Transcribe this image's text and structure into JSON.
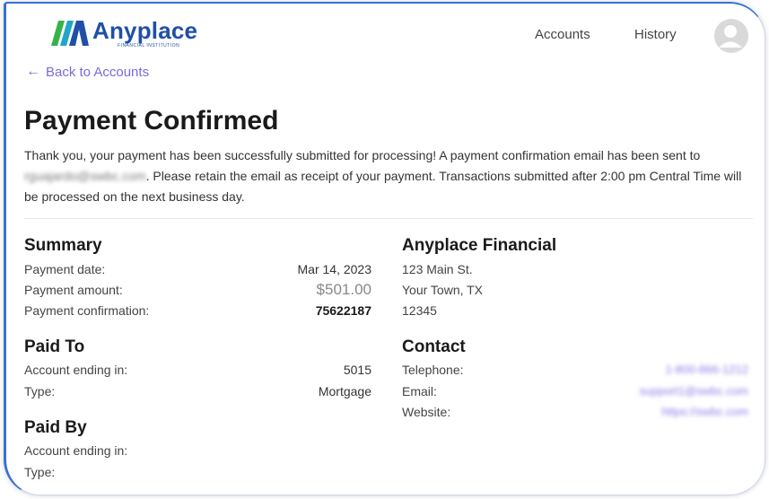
{
  "header": {
    "logo_name": "Anyplace",
    "logo_sub": "FINANCIAL INSTITUTION",
    "nav": [
      "Accounts",
      "History"
    ]
  },
  "back_link": "Back to Accounts",
  "title": "Payment Confirmed",
  "intro": {
    "part1": "Thank you, your payment has been successfully submitted for processing! A payment confirmation email has been sent to",
    "email_blurred": "rguajardo@swbc.com",
    "part2": ". Please retain the email as receipt of your payment. Transactions submitted after 2:00 pm Central Time will be processed on the next business day."
  },
  "summary": {
    "heading": "Summary",
    "rows": [
      {
        "label": "Payment date:",
        "value": "Mar 14, 2023"
      },
      {
        "label": "Payment amount:",
        "value": "$501.00"
      },
      {
        "label": "Payment confirmation:",
        "value": "75622187"
      }
    ]
  },
  "paid_to": {
    "heading": "Paid To",
    "rows": [
      {
        "label": "Account ending in:",
        "value": "5015"
      },
      {
        "label": "Type:",
        "value": "Mortgage"
      }
    ]
  },
  "paid_by": {
    "heading": "Paid By",
    "rows": [
      {
        "label": "Account ending in:"
      },
      {
        "label": "Type:"
      }
    ]
  },
  "institution": {
    "heading": "Anyplace Financial",
    "address": [
      "123 Main St.",
      "Your Town, TX",
      "12345"
    ]
  },
  "contact": {
    "heading": "Contact",
    "rows": [
      {
        "label": "Telephone:",
        "value": "1-800-866-1212"
      },
      {
        "label": "Email:",
        "value": "support1@swbc.com"
      },
      {
        "label": "Website:",
        "value": "https://swbc.com"
      }
    ]
  },
  "colors": {
    "brand_blue": "#1f4fa8",
    "link_purple": "#7a6cd6",
    "logo_green": "#35b34a",
    "logo_teal": "#1fa6c9"
  }
}
